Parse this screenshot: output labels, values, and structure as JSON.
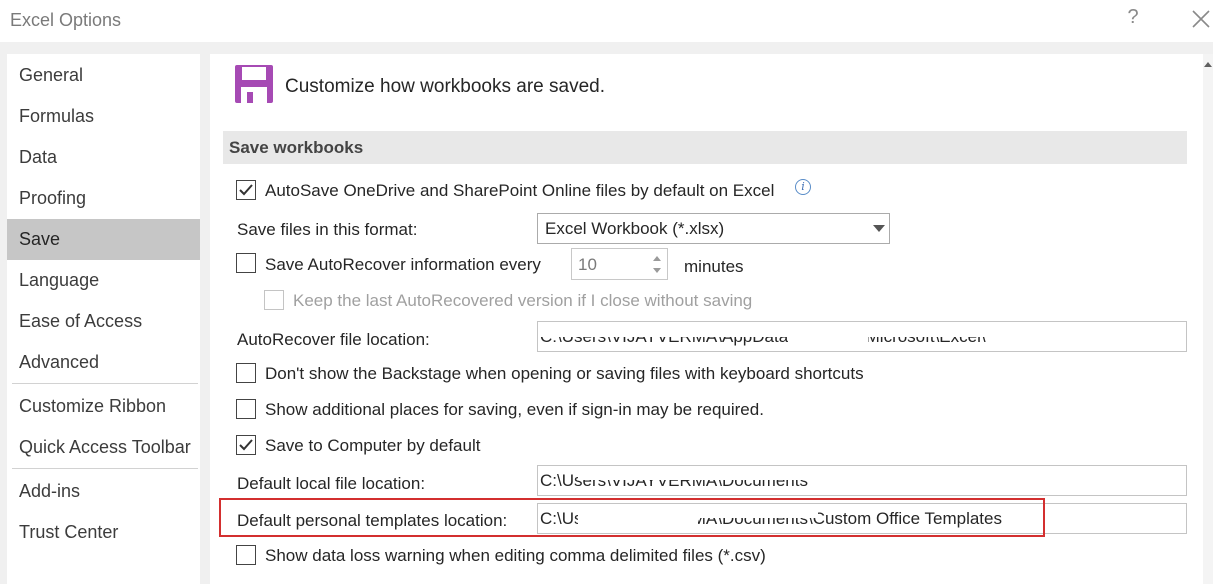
{
  "window": {
    "title": "Excel Options",
    "help_glyph": "?"
  },
  "sidebar": {
    "items": [
      {
        "label": "General"
      },
      {
        "label": "Formulas"
      },
      {
        "label": "Data"
      },
      {
        "label": "Proofing"
      },
      {
        "label": "Save",
        "selected": true
      },
      {
        "label": "Language"
      },
      {
        "label": "Ease of Access"
      },
      {
        "label": "Advanced"
      },
      {
        "label": "Customize Ribbon"
      },
      {
        "label": "Quick Access Toolbar"
      },
      {
        "label": "Add-ins"
      },
      {
        "label": "Trust Center"
      }
    ]
  },
  "main": {
    "heading": "Customize how workbooks are saved.",
    "heading_icon": "floppy-disk-icon",
    "section_title": "Save workbooks",
    "autosave": {
      "label": "AutoSave OneDrive and SharePoint Online files by default on Excel",
      "checked": true
    },
    "save_format": {
      "label": "Save files in this format:",
      "value": "Excel Workbook (*.xlsx)"
    },
    "autorecover": {
      "label": "Save AutoRecover information every",
      "minutes": "10",
      "unit_label": "minutes",
      "checked": false
    },
    "keep_last": {
      "label": "Keep the last AutoRecovered version if I close without saving",
      "checked": false,
      "enabled": false
    },
    "autorecover_location": {
      "label": "AutoRecover file location:",
      "value": "C:\\Users\\VIJAYVERMA\\AppData\\Roaming\\Microsoft\\Excel\\"
    },
    "no_backstage": {
      "label": "Don't show the Backstage when opening or saving files with keyboard shortcuts",
      "checked": false
    },
    "additional_places": {
      "label": "Show additional places for saving, even if sign-in may be required.",
      "checked": false
    },
    "save_to_computer": {
      "label": "Save to Computer by default",
      "checked": true
    },
    "local_location": {
      "label": "Default local file location:",
      "value": "C:\\Users\\VIJAYVERMA\\Documents"
    },
    "templates_location": {
      "label": "Default personal templates location:",
      "value": "C:\\Users\\VIJAYVERMA\\Documents\\Custom Office Templates"
    },
    "data_loss": {
      "label": "Show data loss warning when editing comma delimited files (*.csv)",
      "checked": false
    }
  },
  "colors": {
    "accent_highlight": "#d32f2f",
    "selected_nav": "#c6c6c6",
    "floppy_icon": "#a64ab4"
  }
}
